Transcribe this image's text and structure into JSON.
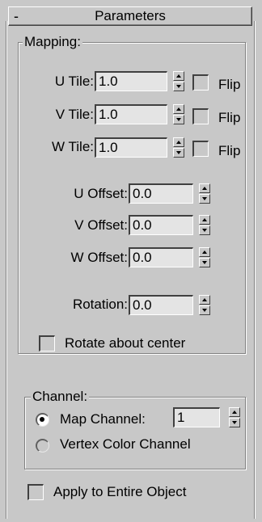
{
  "rollout": {
    "toggle": "-",
    "title": "Parameters"
  },
  "mapping": {
    "legend": "Mapping:",
    "u_tile": {
      "label": "U Tile:",
      "value": "1.0",
      "flip_label": "Flip",
      "flip_checked": false
    },
    "v_tile": {
      "label": "V Tile:",
      "value": "1.0",
      "flip_label": "Flip",
      "flip_checked": false
    },
    "w_tile": {
      "label": "W Tile:",
      "value": "1.0",
      "flip_label": "Flip",
      "flip_checked": false
    },
    "u_offset": {
      "label": "U Offset:",
      "value": "0.0"
    },
    "v_offset": {
      "label": "V Offset:",
      "value": "0.0"
    },
    "w_offset": {
      "label": "W Offset:",
      "value": "0.0"
    },
    "rotation": {
      "label": "Rotation:",
      "value": "0.0"
    },
    "rotate_center": {
      "label": "Rotate about center",
      "checked": false
    }
  },
  "channel": {
    "legend": "Channel:",
    "map_channel": {
      "label": "Map Channel:",
      "value": "1",
      "selected": true
    },
    "vertex_color": {
      "label": "Vertex Color Channel",
      "selected": false
    }
  },
  "apply_entire": {
    "label": "Apply to Entire Object",
    "checked": false
  }
}
